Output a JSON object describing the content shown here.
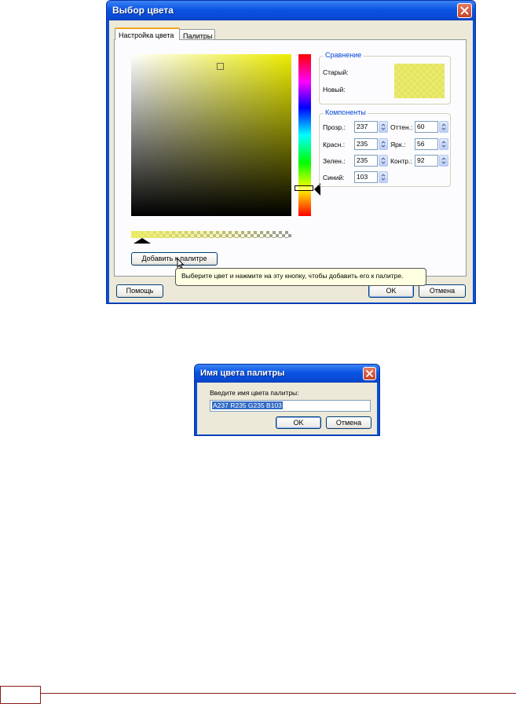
{
  "color_dialog": {
    "title": "Выбор цвета",
    "tabs": [
      {
        "label": "Настройка цвета",
        "active": true
      },
      {
        "label": "Палитры",
        "active": false
      }
    ],
    "comparison": {
      "group_title": "Сравнение",
      "old_label": "Старый:",
      "new_label": "Новый:",
      "swatch_color": "#ecec6a"
    },
    "components": {
      "group_title": "Компоненты",
      "alpha": {
        "label": "Прозр.:",
        "value": "237"
      },
      "red": {
        "label": "Красн.:",
        "value": "235"
      },
      "green": {
        "label": "Зелен.:",
        "value": "235"
      },
      "blue": {
        "label": "Синий:",
        "value": "103"
      },
      "hue": {
        "label": "Оттен.:",
        "value": "60"
      },
      "lightness": {
        "label": "Ярк.:",
        "value": "56"
      },
      "contrast": {
        "label": "Контр.:",
        "value": "92"
      }
    },
    "add_to_palette_label": "Добавить к палитре",
    "tooltip": "Выберите цвет и нажмите на эту кнопку, чтобы добавить его к палитре.",
    "help_label": "Помощь",
    "ok_label": "OK",
    "cancel_label": "Отмена"
  },
  "palette_name_dialog": {
    "title": "Имя цвета палитры",
    "prompt": "Введите имя цвета палитры:",
    "input_value": "A237 R235 G235 B103",
    "ok_label": "OK",
    "cancel_label": "Отмена"
  },
  "colors": {
    "xp_title_blue": "#0a54e3",
    "dialog_bg": "#ece9d8",
    "group_title": "#0046d5",
    "selection": "#316ac5",
    "footer_rule": "#8b1a1a"
  }
}
